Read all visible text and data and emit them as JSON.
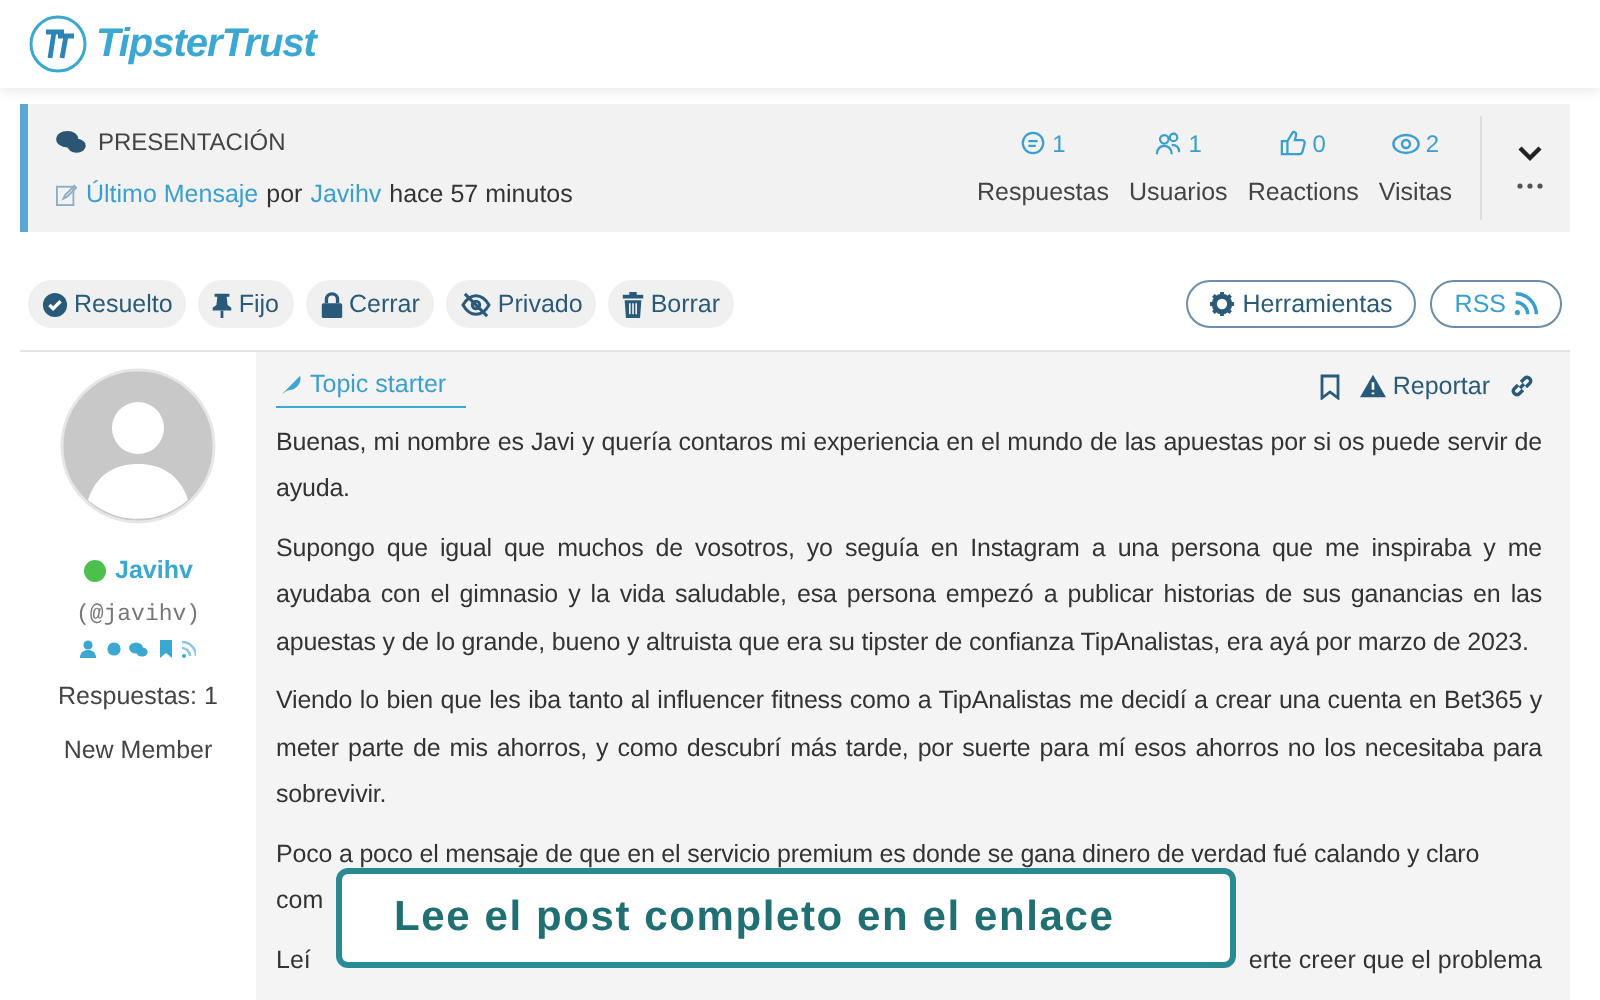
{
  "logo": {
    "text": "TipsterTrust"
  },
  "topic": {
    "forum": "PRESENTACIÓN",
    "last_link": "Último Mensaje",
    "by": "por",
    "author": "Javihv",
    "time": "hace 57 minutos"
  },
  "stats": [
    {
      "kind": "replies",
      "value": "1",
      "label": "Respuestas"
    },
    {
      "kind": "users",
      "value": "1",
      "label": "Usuarios"
    },
    {
      "kind": "reactions",
      "value": "0",
      "label": "Reactions"
    },
    {
      "kind": "views",
      "value": "2",
      "label": "Visitas"
    }
  ],
  "actions": [
    {
      "kind": "check",
      "label": "Resuelto"
    },
    {
      "kind": "pin",
      "label": "Fijo"
    },
    {
      "kind": "lock",
      "label": "Cerrar"
    },
    {
      "kind": "eye",
      "label": "Privado"
    },
    {
      "kind": "trash",
      "label": "Borrar"
    }
  ],
  "tools": [
    {
      "kind": "gear",
      "label": "Herramientas"
    },
    {
      "kind": "rss",
      "label": "RSS"
    }
  ],
  "user": {
    "online": true,
    "name": "Javihv",
    "handle": "(@javihv)",
    "replies": "Respuestas: 1",
    "rank": "New Member"
  },
  "post": {
    "badge": "Topic starter",
    "report": "Reportar",
    "paragraphs": [
      "Buenas, mi nombre es Javi y quería contaros mi experiencia en el mundo de las apuestas por si os puede servir de ayuda.",
      "Supongo que igual que muchos de vosotros, yo seguía en Instagram a una persona que me inspiraba y me ayudaba con el gimnasio y la vida saludable, esa persona empezó a publicar historias de sus ganancias en las apuestas y de lo grande, bueno y altruista que era su tipster de confianza TipAnalistas, era ayá por marzo de 2023.",
      "Viendo lo bien que les iba tanto al influencer fitness como a TipAnalistas me decidí a crear una cuenta en Bet365 y meter parte de mis ahorros, y como descubrí más tarde, por suerte para mí esos ahorros no los necesitaba para sobrevivir.",
      "Poco a poco el mensaje de que en el servicio premium es donde se gana dinero de verdad fué calando y claro"
    ],
    "fragments": [
      "com",
      "Leí",
      "erte creer que el problema"
    ]
  },
  "banner": "Lee el post completo en el enlace"
}
